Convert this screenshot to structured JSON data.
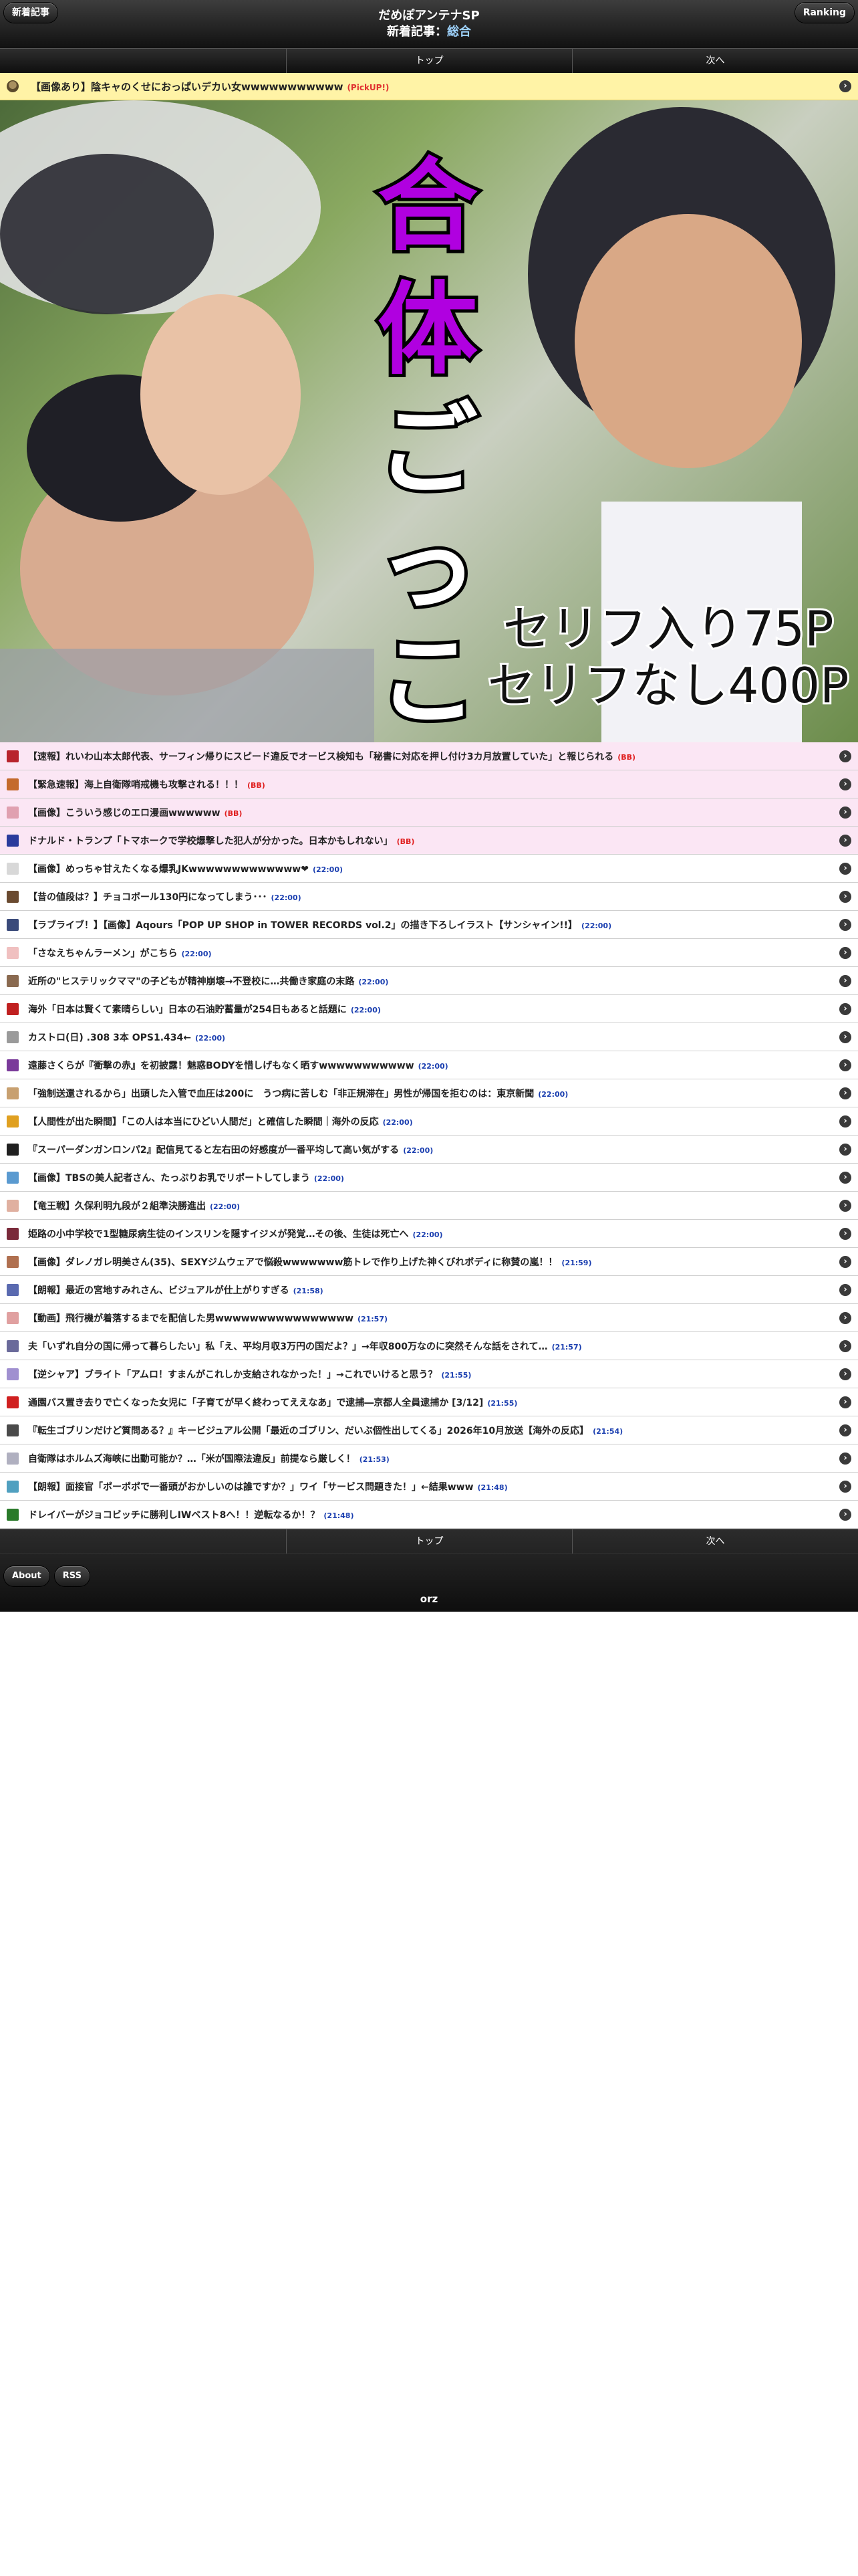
{
  "header": {
    "left_button": "新着記事",
    "right_button": "Ranking",
    "title": "だめぽアンテナSP",
    "subtitle_prefix": "新着記事：",
    "subtitle_category": "総合"
  },
  "nav": {
    "top": "トップ",
    "next": "次へ"
  },
  "pickup": {
    "title": "【画像あり】陰キャのくせにおっぱいデカい女wwwwwwwwwww",
    "tag": "(PickUP!)"
  },
  "banner": {
    "line1": "合体ごっこ",
    "line2": "セリフ入り75P",
    "line3": "セリフなし400P"
  },
  "articles": [
    {
      "title": "【速報】れいわ山本太郎代表、サーフィン帰りにスピード違反でオービス検知も「秘書に対応を押し付け3カ月放置していた」と報じられる",
      "time": "(BB)",
      "hl": true,
      "c": "#b8232c"
    },
    {
      "title": "【緊急速報】海上自衛隊哨戒機も攻撃される！！！",
      "time": "(BB)",
      "hl": true,
      "c": "#c46a2c"
    },
    {
      "title": "【画像】こういう感じのエロ漫画wwwwww",
      "time": "(BB)",
      "hl": true,
      "c": "#e0a0b0"
    },
    {
      "title": "ドナルド・トランプ「トマホークで学校爆撃した犯人が分かった。日本かもしれない」",
      "time": "(BB)",
      "hl": true,
      "c": "#2a3b9c"
    },
    {
      "title": "【画像】めっちゃ甘えたくなる爆乳JKwwwwwwwwwwwww❤",
      "time": "(22:00)",
      "hl": false,
      "c": "#d8d8d8"
    },
    {
      "title": "【昔の値段は？】チョコボール130円になってしまう･･･",
      "time": "(22:00)",
      "hl": false,
      "c": "#6a4a30"
    },
    {
      "title": "【ラブライブ！】【画像】Aqours「POP UP SHOP in TOWER RECORDS vol.2」の描き下ろしイラスト【サンシャイン!!】",
      "time": "(22:00)",
      "hl": false,
      "c": "#3a4a7a"
    },
    {
      "title": "「さなえちゃんラーメン」がこちら",
      "time": "(22:00)",
      "hl": false,
      "c": "#f0c0c0"
    },
    {
      "title": "近所の\"ヒステリックママ\"の子どもが精神崩壊→不登校に…共働き家庭の末路",
      "time": "(22:00)",
      "hl": false,
      "c": "#8a6a50"
    },
    {
      "title": "海外「日本は賢くて素晴らしい」日本の石油貯蓄量が254日もあると話題に",
      "time": "(22:00)",
      "hl": false,
      "c": "#c02020"
    },
    {
      "title": "カストロ(日) .308 3本 OPS1.434←",
      "time": "(22:00)",
      "hl": false,
      "c": "#9a9a9a"
    },
    {
      "title": "遠藤さくらが『衝撃の赤』を初披露！魅惑BODYを惜しげもなく晒すwwwwwwwwwww",
      "time": "(22:00)",
      "hl": false,
      "c": "#7a3a9a"
    },
    {
      "title": "「強制送還されるから」出頭した入管で血圧は200に　うつ病に苦しむ「非正規滞在」男性が帰国を拒むのは：東京新聞",
      "time": "(22:00)",
      "hl": false,
      "c": "#c8a070"
    },
    {
      "title": "【人間性が出た瞬間】「この人は本当にひどい人間だ」と確信した瞬間｜海外の反応",
      "time": "(22:00)",
      "hl": false,
      "c": "#e0a020"
    },
    {
      "title": "『スーパーダンガンロンパ2』配信見てると左右田の好感度が一番平均して高い気がする",
      "time": "(22:00)",
      "hl": false,
      "c": "#202020"
    },
    {
      "title": "【画像】TBSの美人記者さん、たっぷりお乳でリポートしてしまう",
      "time": "(22:00)",
      "hl": false,
      "c": "#5a9ad0"
    },
    {
      "title": "【竜王戦】久保利明九段が２組準決勝進出",
      "time": "(22:00)",
      "hl": false,
      "c": "#e0b0a0"
    },
    {
      "title": "姫路の小中学校で1型糖尿病生徒のインスリンを隠すイジメが発覚…その後、生徒は死亡へ",
      "time": "(22:00)",
      "hl": false,
      "c": "#7a2a3a"
    },
    {
      "title": "【画像】ダレノガレ明美さん(35)、SEXYジムウェアで悩殺wwwwwww筋トレで作り上げた神くびれボディに称賛の嵐！！",
      "time": "(21:59)",
      "hl": false,
      "c": "#b07050"
    },
    {
      "title": "【朗報】最近の宮地すみれさん、ビジュアルが仕上がりすぎる",
      "time": "(21:58)",
      "hl": false,
      "c": "#5a6ab0"
    },
    {
      "title": "【動画】飛行機が着落するまでを配信した男wwwwwwwwwwwwwwww",
      "time": "(21:57)",
      "hl": false,
      "c": "#e0a0a0"
    },
    {
      "title": "夫「いずれ自分の国に帰って暮らしたい」私「え、平均月収3万円の国だよ？」→年収800万なのに突然そんな話をされて…",
      "time": "(21:57)",
      "hl": false,
      "c": "#6a6a9a"
    },
    {
      "title": "【逆シャア】ブライト「アムロ！すまんがこれしか支給されなかった！」→これでいけると思う？",
      "time": "(21:55)",
      "hl": false,
      "c": "#a090d0"
    },
    {
      "title": "通園バス置き去りで亡くなった女児に「子育てが早く終わってええなあ」で逮捕―京都人全員逮捕か [3/12]",
      "time": "(21:55)",
      "hl": false,
      "c": "#d02020"
    },
    {
      "title": "『転生ゴブリンだけど質問ある？』キービジュアル公開「最近のゴブリン、だいぶ個性出してくる」2026年10月放送【海外の反応】",
      "time": "(21:54)",
      "hl": false,
      "c": "#4a4a4a"
    },
    {
      "title": "自衛隊はホルムズ海峡に出動可能か？…「米が国際法違反」前提なら厳しく！",
      "time": "(21:53)",
      "hl": false,
      "c": "#b0b0c0"
    },
    {
      "title": "【朗報】面接官「ポーポポで一番頭がおかしいのは誰ですか？」ワイ「サービス問題きた！」←結果www",
      "time": "(21:48)",
      "hl": false,
      "c": "#50a0c0"
    },
    {
      "title": "ドレイバーがジョコビッチに勝利しIWベスト8へ！！逆転なるか！？",
      "time": "(21:48)",
      "hl": false,
      "c": "#2a7a2a"
    }
  ],
  "footer": {
    "about": "About",
    "rss": "RSS",
    "orz": "orz"
  }
}
